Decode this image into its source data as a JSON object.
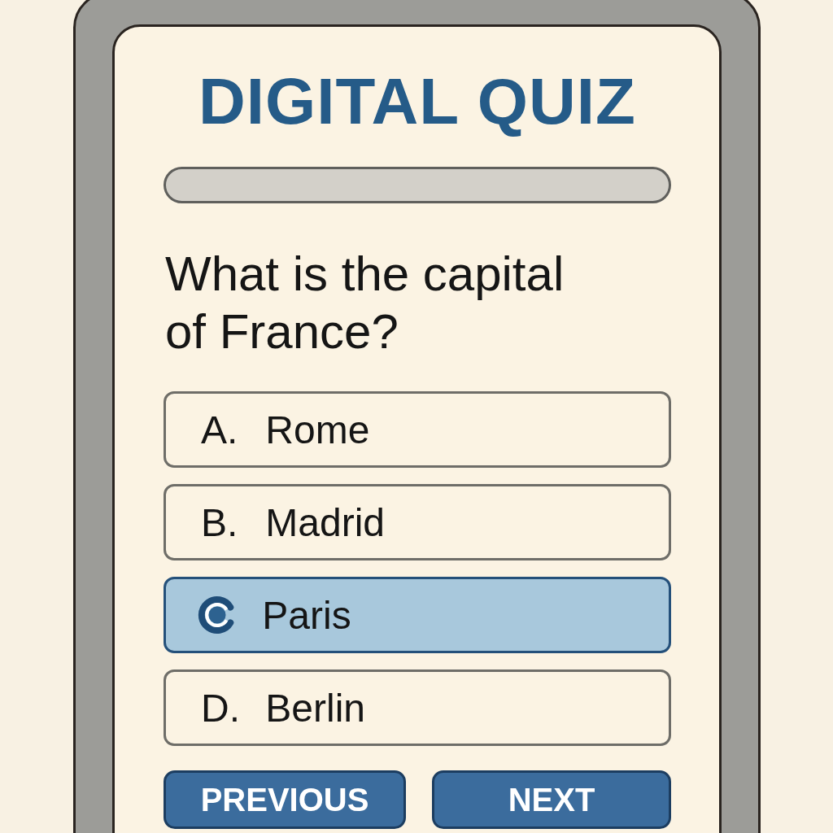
{
  "title": "DIGITAL QUIZ",
  "question": "What is the capital of France?",
  "options": [
    {
      "letter": "A.",
      "text": "Rome",
      "selected": false
    },
    {
      "letter": "B.",
      "text": "Madrid",
      "selected": false
    },
    {
      "text": "Paris",
      "selected": true
    },
    {
      "letter": "D.",
      "text": "Berlin",
      "selected": false
    }
  ],
  "buttons": [
    {
      "label": "PREVIOUS"
    },
    {
      "label": "NEXT"
    }
  ]
}
